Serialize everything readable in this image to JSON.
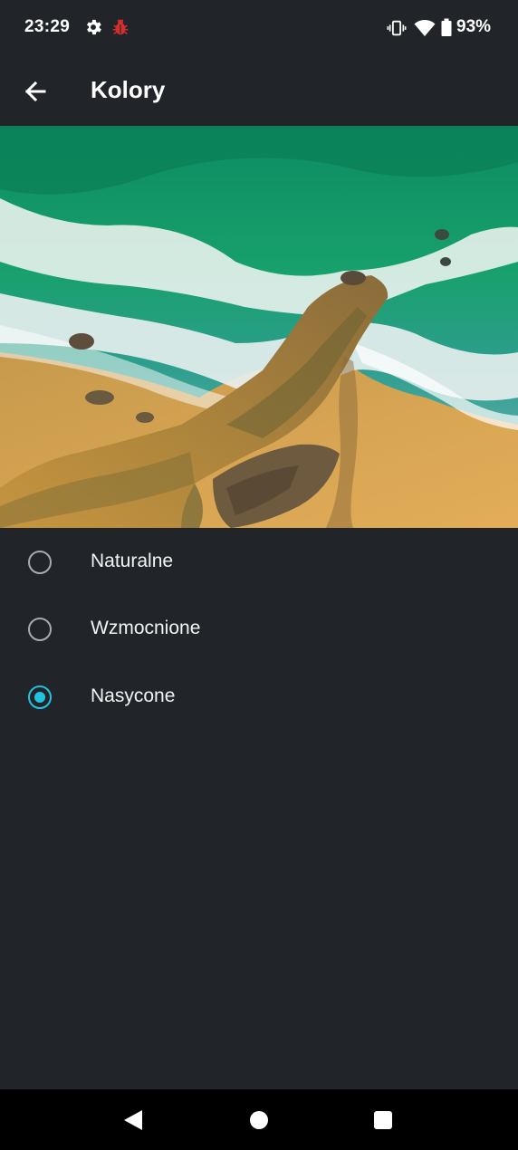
{
  "status_bar": {
    "time": "23:29",
    "battery_percent": "93%",
    "icons": [
      "gear-icon",
      "bug-icon",
      "vibrate-icon",
      "wifi-icon",
      "battery-icon"
    ]
  },
  "app_bar": {
    "title": "Kolory",
    "back_icon": "arrow-back-icon"
  },
  "preview": {
    "subject": "aerial beach wallpaper"
  },
  "options": [
    {
      "label": "Naturalne",
      "selected": false
    },
    {
      "label": "Wzmocnione",
      "selected": false
    },
    {
      "label": "Nasycone",
      "selected": true
    }
  ],
  "colors": {
    "background": "#212529",
    "accent": "#22c3e0",
    "radio_unselected": "#a7abb0",
    "bug_icon": "#d32f2f"
  },
  "nav_bar": {
    "icons": [
      "nav-back-icon",
      "nav-home-icon",
      "nav-recents-icon"
    ]
  }
}
